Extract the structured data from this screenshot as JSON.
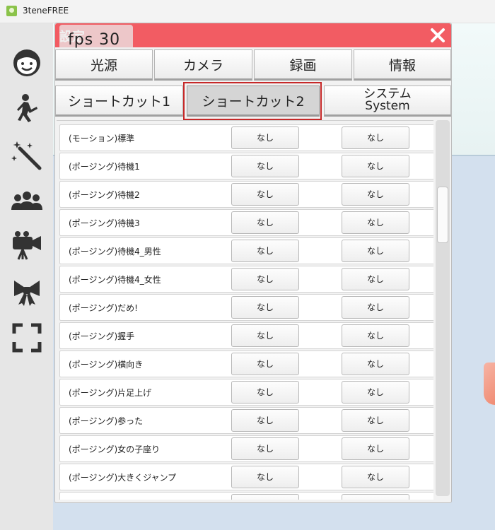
{
  "window": {
    "title": "3teneFREE"
  },
  "panel": {
    "title": "設定",
    "fps": "fps  30"
  },
  "tabs_row1": [
    {
      "label": "光源"
    },
    {
      "label": "カメラ"
    },
    {
      "label": "録画"
    },
    {
      "label": "情報"
    }
  ],
  "tabs_row2": [
    {
      "label": "ショートカット1"
    },
    {
      "label": "ショートカット2",
      "selected": true
    },
    {
      "label_ja": "システム",
      "label_en": "System"
    }
  ],
  "rows": [
    {
      "label": "(モーション)標準",
      "key1": "なし",
      "key2": "なし"
    },
    {
      "label": "(ポージング)待機1",
      "key1": "なし",
      "key2": "なし"
    },
    {
      "label": "(ポージング)待機2",
      "key1": "なし",
      "key2": "なし"
    },
    {
      "label": "(ポージング)待機3",
      "key1": "なし",
      "key2": "なし"
    },
    {
      "label": "(ポージング)待機4_男性",
      "key1": "なし",
      "key2": "なし"
    },
    {
      "label": "(ポージング)待機4_女性",
      "key1": "なし",
      "key2": "なし"
    },
    {
      "label": "(ポージング)だめ!",
      "key1": "なし",
      "key2": "なし"
    },
    {
      "label": "(ポージング)握手",
      "key1": "なし",
      "key2": "なし"
    },
    {
      "label": "(ポージング)横向き",
      "key1": "なし",
      "key2": "なし"
    },
    {
      "label": "(ポージング)片足上げ",
      "key1": "なし",
      "key2": "なし"
    },
    {
      "label": "(ポージング)参った",
      "key1": "なし",
      "key2": "なし"
    },
    {
      "label": "(ポージング)女の子座り",
      "key1": "なし",
      "key2": "なし"
    },
    {
      "label": "(ポージング)大きくジャンプ",
      "key1": "なし",
      "key2": "なし"
    },
    {
      "label": "",
      "key1": "",
      "key2": ""
    }
  ],
  "sidebar": [
    {
      "icon": "avatar-face-icon"
    },
    {
      "icon": "pose-figure-icon"
    },
    {
      "icon": "magic-wand-icon"
    },
    {
      "icon": "group-icon"
    },
    {
      "icon": "camera-icon"
    },
    {
      "icon": "ribbon-icon"
    },
    {
      "icon": "fullscreen-icon"
    }
  ],
  "colors": {
    "header": "#f25c63",
    "highlight": "#c62828",
    "sidebar": "#e6e6e6"
  }
}
